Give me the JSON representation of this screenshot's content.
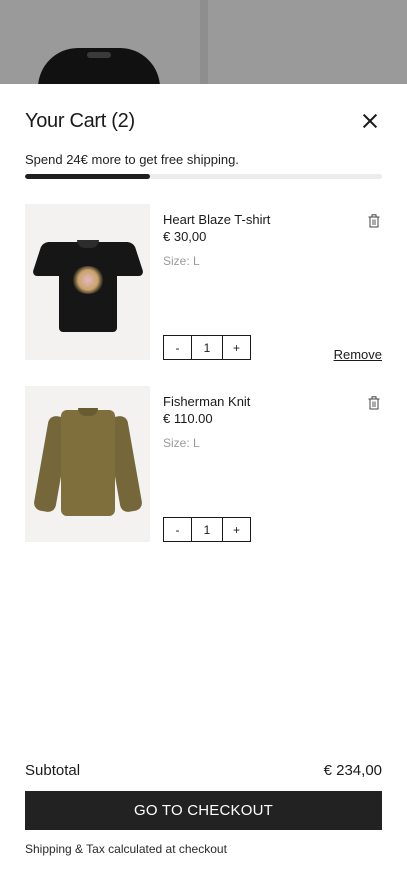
{
  "cart": {
    "title": "Your Cart (2)",
    "shipping_message": "Spend 24€ more to get free shipping.",
    "shipping_progress": 0.35
  },
  "items": [
    {
      "name": "Heart Blaze T-shirt",
      "price": "€ 30,00",
      "size": "Size: L",
      "qty_minus": "-",
      "quantity": "1",
      "qty_plus": "+",
      "remove_label": "Remove",
      "image": "black-tshirt-graphic"
    },
    {
      "name": "Fisherman Knit",
      "price": "€ 110.00",
      "size": "Size: L",
      "qty_minus": "-",
      "quantity": "1",
      "qty_plus": "+",
      "image": "olive-knit-sweater"
    }
  ],
  "summary": {
    "subtotal_label": "Subtotal",
    "subtotal_value": "€ 234,00",
    "checkout_label": "GO TO CHECKOUT",
    "tax_note": "Shipping & Tax calculated at checkout"
  },
  "colors": {
    "primary": "#222222",
    "progress_track": "#ececec",
    "muted_text": "#9a9a9a"
  },
  "icons": {
    "close": "close-icon",
    "trash": "trash-icon"
  }
}
